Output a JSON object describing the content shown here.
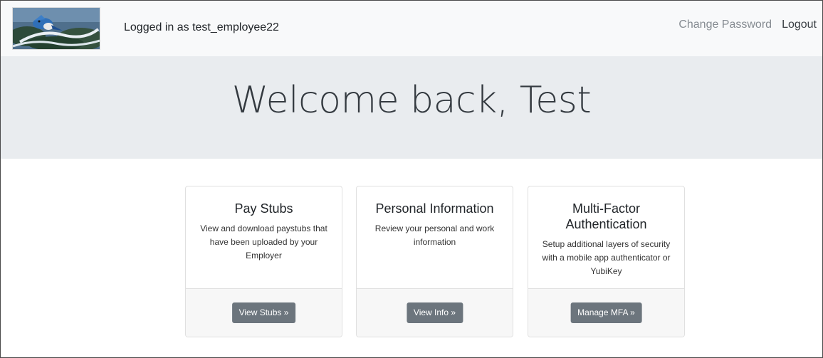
{
  "navbar": {
    "logo_icon": "blue-jay-photo-icon",
    "user_text": "Logged in as test_employee22",
    "change_password": "Change Password",
    "logout": "Logout"
  },
  "jumbotron": {
    "title": "Welcome back, Test"
  },
  "cards": [
    {
      "title": "Pay Stubs",
      "text": "View and download paystubs that have been uploaded by your Employer",
      "button": "View Stubs »"
    },
    {
      "title": "Personal Information",
      "text": "Review your personal and work information",
      "button": "View Info »"
    },
    {
      "title": "Multi-Factor Authentication",
      "text": "Setup additional layers of security with a mobile app authenticator or YubiKey",
      "button": "Manage MFA »"
    }
  ],
  "colors": {
    "navbar_bg": "#f8f9fa",
    "jumbotron_bg": "#e9ecef",
    "button_bg": "#6c757d"
  }
}
